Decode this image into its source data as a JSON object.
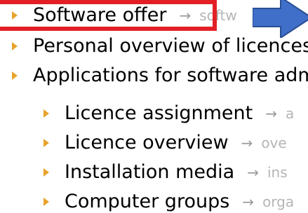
{
  "menu": {
    "items": [
      {
        "label": "Software offer",
        "arrow": "→",
        "hint": "softw"
      },
      {
        "label": "Personal overview of licences"
      },
      {
        "label": "Applications for software adm"
      }
    ],
    "subitems": [
      {
        "label": "Licence assignment",
        "arrow": "→",
        "hint": "a"
      },
      {
        "label": "Licence overview",
        "arrow": "→",
        "hint": "ove"
      },
      {
        "label": "Installation media",
        "arrow": "→",
        "hint": "ins"
      },
      {
        "label": "Computer groups",
        "arrow": "→",
        "hint": "orga"
      }
    ]
  },
  "annotation": {
    "highlight_color": "#e31f26",
    "pointer_color": "#3f6fc8"
  }
}
